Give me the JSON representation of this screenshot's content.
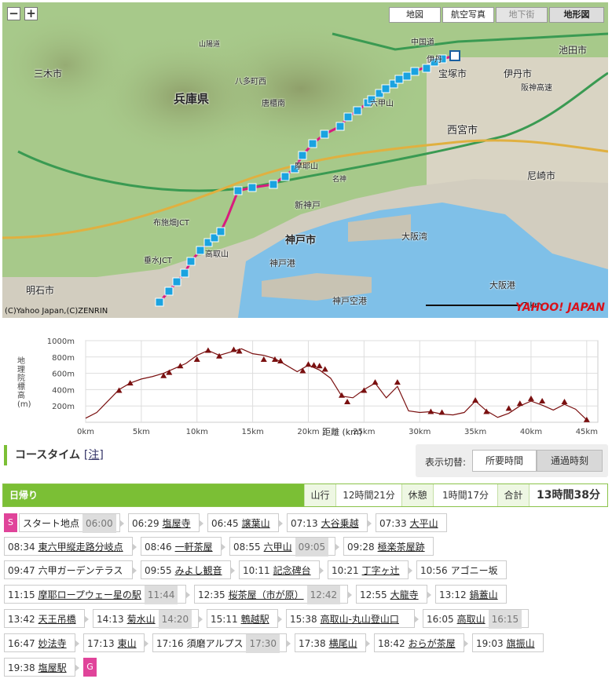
{
  "map": {
    "buttons": [
      "地図",
      "航空写真",
      "地下街",
      "地形図"
    ],
    "zoom_out": "−",
    "zoom_in": "+",
    "copyright": "(C)Yahoo Japan,(C)ZENRIN",
    "scale": "7 km",
    "logo": "YAHOO! JAPAN",
    "labels": [
      "兵庫県",
      "三木市",
      "神戸市",
      "明石市",
      "宝塚市",
      "西宮市",
      "尼崎市",
      "伊丹市",
      "池田市",
      "大阪湾",
      "神戸港",
      "大阪港",
      "神戸空港",
      "六甲山",
      "摩耶山",
      "高取山",
      "新神戸",
      "布施畑JCT",
      "垂水JCT",
      "唐櫃南",
      "八多町西",
      "中国道",
      "山陽道",
      "名神",
      "阪神高速",
      "伊丹",
      "宝塚"
    ]
  },
  "elevation": {
    "ylabel": "地理院 標高 (m)",
    "xlabel": "距離 (km)",
    "yticks": [
      "1000m",
      "800m",
      "600m",
      "400m",
      "200m"
    ],
    "xticks": [
      "0km",
      "5km",
      "10km",
      "15km",
      "20km",
      "25km",
      "30km",
      "35km",
      "40km",
      "45km"
    ],
    "profile": [
      [
        0,
        50
      ],
      [
        1,
        120
      ],
      [
        2,
        260
      ],
      [
        3,
        400
      ],
      [
        4,
        480
      ],
      [
        5,
        530
      ],
      [
        6,
        560
      ],
      [
        7,
        600
      ],
      [
        8,
        660
      ],
      [
        9,
        720
      ],
      [
        10,
        820
      ],
      [
        11,
        880
      ],
      [
        12,
        820
      ],
      [
        13,
        860
      ],
      [
        14,
        900
      ],
      [
        15,
        840
      ],
      [
        16,
        820
      ],
      [
        17,
        780
      ],
      [
        18,
        700
      ],
      [
        19,
        620
      ],
      [
        20,
        700
      ],
      [
        21,
        640
      ],
      [
        22,
        540
      ],
      [
        23,
        320
      ],
      [
        24,
        300
      ],
      [
        25,
        400
      ],
      [
        26,
        480
      ],
      [
        27,
        300
      ],
      [
        28,
        440
      ],
      [
        29,
        140
      ],
      [
        30,
        120
      ],
      [
        31,
        130
      ],
      [
        32,
        100
      ],
      [
        33,
        90
      ],
      [
        34,
        120
      ],
      [
        35,
        260
      ],
      [
        36,
        140
      ],
      [
        37,
        60
      ],
      [
        38,
        110
      ],
      [
        39,
        200
      ],
      [
        40,
        260
      ],
      [
        41,
        210
      ],
      [
        42,
        150
      ],
      [
        43,
        220
      ],
      [
        44,
        160
      ],
      [
        45,
        30
      ]
    ],
    "markers": [
      [
        3,
        380
      ],
      [
        4,
        470
      ],
      [
        7,
        560
      ],
      [
        7.5,
        600
      ],
      [
        8.5,
        680
      ],
      [
        10,
        760
      ],
      [
        11,
        870
      ],
      [
        12,
        800
      ],
      [
        13.3,
        880
      ],
      [
        13.8,
        860
      ],
      [
        16,
        760
      ],
      [
        17,
        760
      ],
      [
        17.5,
        740
      ],
      [
        19.5,
        620
      ],
      [
        20,
        700
      ],
      [
        20.5,
        690
      ],
      [
        21,
        680
      ],
      [
        21.5,
        640
      ],
      [
        23,
        320
      ],
      [
        23.5,
        240
      ],
      [
        25,
        380
      ],
      [
        26,
        480
      ],
      [
        28,
        480
      ],
      [
        31,
        120
      ],
      [
        32,
        110
      ],
      [
        35,
        260
      ],
      [
        36,
        120
      ],
      [
        38,
        160
      ],
      [
        39,
        220
      ],
      [
        40,
        280
      ],
      [
        41,
        250
      ],
      [
        43,
        240
      ],
      [
        45,
        20
      ]
    ]
  },
  "course": {
    "title": "コースタイム",
    "note": "[注]",
    "toggle_label": "表示切替:",
    "toggle_options": [
      "所要時間",
      "通過時刻"
    ],
    "day_label": "日帰り",
    "climb_label": "山行",
    "climb_time": "12時間21分",
    "rest_label": "休憩",
    "rest_time": "1時間17分",
    "total_label": "合計",
    "total_time": "13時間38分"
  },
  "rows": [
    [
      {
        "badge": "S"
      },
      {
        "n": "スタート地点",
        "plain": true,
        "d": "06:00"
      },
      {
        "t": "06:29",
        "n": "塩屋寺"
      },
      {
        "t": "06:45",
        "n": "譲葉山"
      },
      {
        "t": "07:13",
        "n": "大谷乗越"
      },
      {
        "t": "07:33",
        "n": "大平山"
      }
    ],
    [
      {
        "t": "08:34",
        "n": "東六甲縦走路分岐点"
      },
      {
        "t": "08:46",
        "n": "一軒茶屋"
      },
      {
        "t": "08:55",
        "n": "六甲山",
        "d": "09:05"
      },
      {
        "t": "09:28",
        "n": "極楽茶屋跡"
      }
    ],
    [
      {
        "t": "09:47",
        "n": "六甲ガーデンテラス",
        "plain": true
      },
      {
        "t": "09:55",
        "n": "みよし観音"
      },
      {
        "t": "10:11",
        "n": "記念碑台"
      },
      {
        "t": "10:21",
        "n": "丁字ヶ辻"
      },
      {
        "t": "10:56",
        "n": "アゴニー坂",
        "plain": true
      }
    ],
    [
      {
        "t": "11:15",
        "n": "摩耶ロープウェー星の駅",
        "d": "11:44"
      },
      {
        "t": "12:35",
        "n": "桜茶屋（市が原）",
        "d": "12:42"
      },
      {
        "t": "12:55",
        "n": "大龍寺"
      },
      {
        "t": "13:12",
        "n": "鍋蓋山"
      }
    ],
    [
      {
        "t": "13:42",
        "n": "天王吊橋"
      },
      {
        "t": "14:13",
        "n": "菊水山",
        "d": "14:20"
      },
      {
        "t": "15:11",
        "n": "鵯越駅"
      },
      {
        "t": "15:38",
        "n": "高取山-丸山登山口"
      },
      {
        "t": "16:05",
        "n": "高取山",
        "d": "16:15"
      }
    ],
    [
      {
        "t": "16:47",
        "n": "妙法寺"
      },
      {
        "t": "17:13",
        "n": "東山"
      },
      {
        "t": "17:16",
        "n": "須磨アルプス",
        "plain": true,
        "d": "17:30"
      },
      {
        "t": "17:38",
        "n": "横尾山"
      },
      {
        "t": "18:42",
        "n": "おらが茶屋"
      },
      {
        "t": "19:03",
        "n": "旗振山"
      }
    ],
    [
      {
        "t": "19:38",
        "n": "塩屋駅"
      },
      {
        "badge": "G"
      }
    ]
  ],
  "colors": {
    "accent": "#7bbf35",
    "badge": "#e0449a",
    "route": "#d81b7e",
    "marker": "#7a1010",
    "waypoint": "#1aa3e0"
  }
}
